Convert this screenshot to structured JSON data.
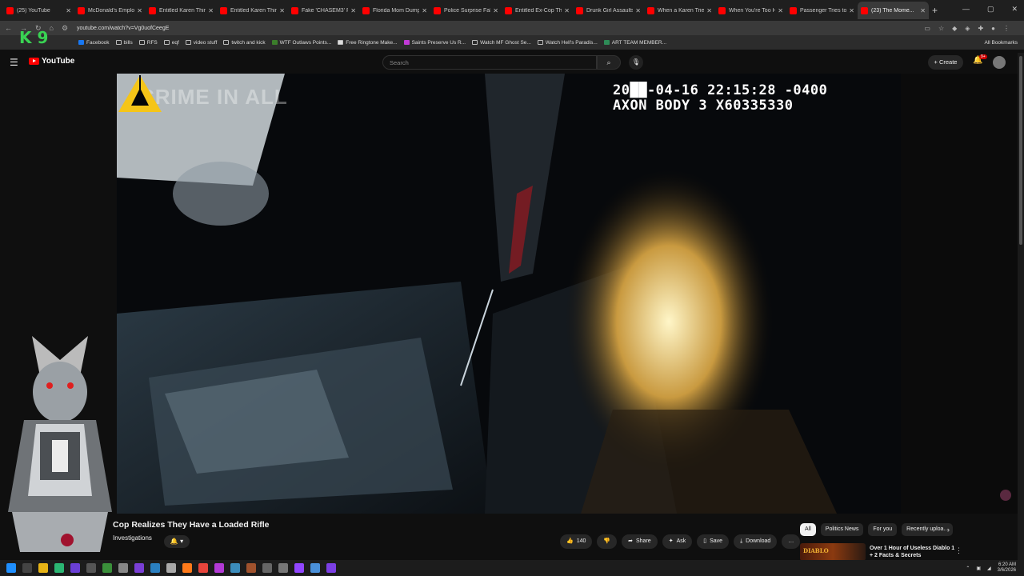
{
  "browser": {
    "tabs": [
      {
        "label": "(25) YouTube"
      },
      {
        "label": "McDonald's Employ..."
      },
      {
        "label": "Entitled Karen Think..."
      },
      {
        "label": "Entitled Karen Think..."
      },
      {
        "label": "Fake 'CHASEM3' Po..."
      },
      {
        "label": "Florida Mom Dump..."
      },
      {
        "label": "Police Surprise Fake..."
      },
      {
        "label": "Entitled Ex-Cop Thi..."
      },
      {
        "label": "Drunk Girl Assaults..."
      },
      {
        "label": "When a Karen Tries..."
      },
      {
        "label": "When You're Too Hi..."
      },
      {
        "label": "Passenger Tries to F..."
      },
      {
        "label": "(23) The Mome..."
      }
    ],
    "url": "youtube.com/watch?v=Vg0uofCeegE",
    "bookmarks": [
      "Facebook",
      "bills",
      "RFS",
      "eqf",
      "video stuff",
      "twitch and kick",
      "WTF Outlaws Points...",
      "Free Ringtone Make...",
      "Saints Preserve Us R...",
      "Watch MF Ghost Se...",
      "Watch Hell's Paradis...",
      "ART TEAM MEMBER..."
    ],
    "all_bookmarks": "All Bookmarks"
  },
  "youtube": {
    "logo_text": "YouTube",
    "search_placeholder": "Search",
    "create_label": "Create",
    "notif_badge": "9+"
  },
  "video": {
    "osd_line1": "20██-04-16 22:15:28 -0400",
    "osd_line2": "AXON BODY 3 X60335330",
    "watermark": "CRIME IN ALL",
    "title": "Cop Realizes They Have a Loaded Rifle",
    "channel": "Investigations"
  },
  "actions": {
    "like_count": "140",
    "share": "Share",
    "ask": "Ask",
    "save": "Save",
    "download": "Download"
  },
  "chips": [
    "All",
    "Politics News",
    "For you",
    "Recently uploa..."
  ],
  "recommendation": {
    "thumb_text": "DIABLO",
    "title": "Over 1 Hour of Useless Diablo 1 + 2 Facts & Secrets"
  },
  "overlay": {
    "k_logo": "K 9"
  },
  "taskbar": {
    "time": "6:20 AM",
    "date": "3/6/2026"
  },
  "colors": {
    "brand": "#ff0000",
    "osd_text": "#ffffff",
    "axon_logo": "#f5c518"
  }
}
